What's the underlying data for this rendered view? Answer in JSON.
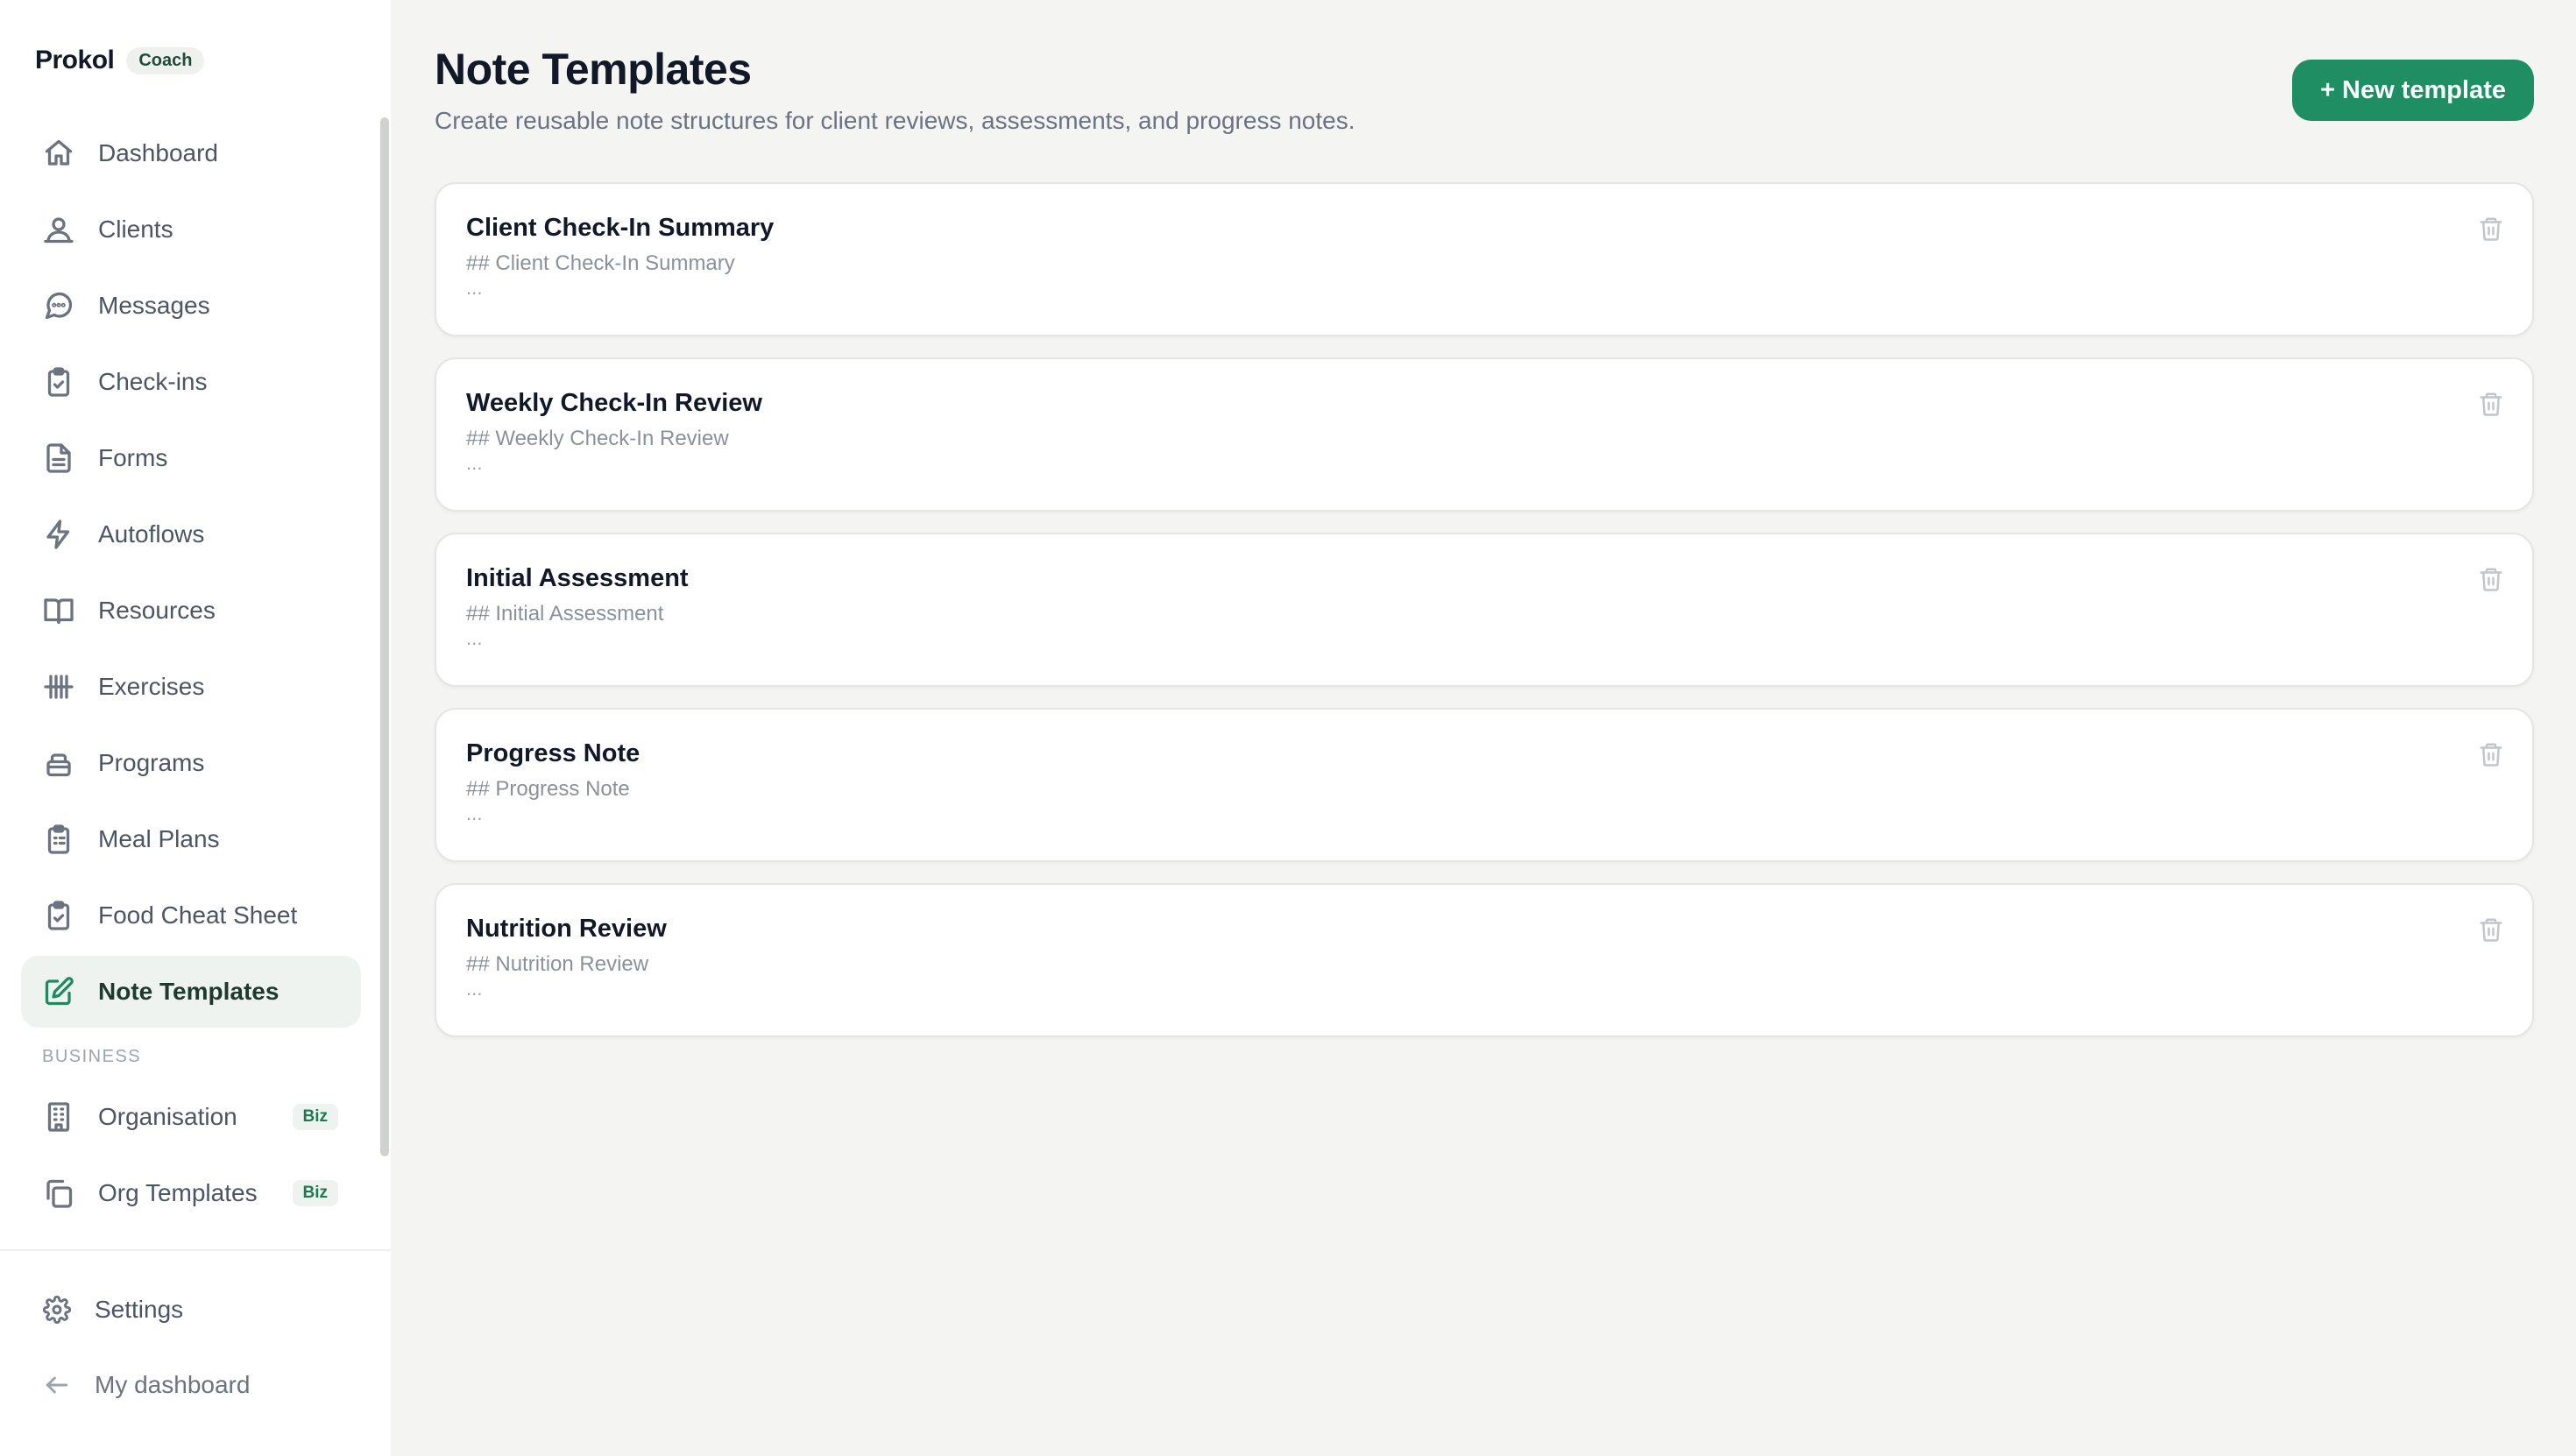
{
  "brand": {
    "name": "Prokol",
    "badge": "Coach"
  },
  "nav": [
    {
      "label": "Dashboard",
      "icon": "home-icon"
    },
    {
      "label": "Clients",
      "icon": "users-icon"
    },
    {
      "label": "Messages",
      "icon": "message-circle-icon"
    },
    {
      "label": "Check-ins",
      "icon": "clipboard-check-icon"
    },
    {
      "label": "Forms",
      "icon": "file-text-icon"
    },
    {
      "label": "Autoflows",
      "icon": "zap-icon"
    },
    {
      "label": "Resources",
      "icon": "book-open-icon"
    },
    {
      "label": "Exercises",
      "icon": "dumbbell-icon"
    },
    {
      "label": "Programs",
      "icon": "layers-icon"
    },
    {
      "label": "Meal Plans",
      "icon": "clipboard-list-icon"
    },
    {
      "label": "Food Cheat Sheet",
      "icon": "clipboard-check-icon"
    },
    {
      "label": "Note Templates",
      "icon": "edit-icon",
      "active": true
    }
  ],
  "business": {
    "section_label": "BUSINESS",
    "items": [
      {
        "label": "Organisation",
        "badge": "Biz",
        "icon": "building-icon"
      },
      {
        "label": "Org Templates",
        "badge": "Biz",
        "icon": "copy-icon"
      }
    ]
  },
  "bottom": {
    "settings_label": "Settings",
    "my_dashboard_label": "My dashboard"
  },
  "header": {
    "title": "Note Templates",
    "subtitle": "Create reusable note structures for client reviews, assessments, and progress notes.",
    "new_button_label": "+ New template"
  },
  "templates": [
    {
      "title": "Client Check-In Summary",
      "preview": "## Client Check-In Summary",
      "more": "..."
    },
    {
      "title": "Weekly Check-In Review",
      "preview": "## Weekly Check-In Review",
      "more": "..."
    },
    {
      "title": "Initial Assessment",
      "preview": "## Initial Assessment",
      "more": "..."
    },
    {
      "title": "Progress Note",
      "preview": "## Progress Note",
      "more": "..."
    },
    {
      "title": "Nutrition Review",
      "preview": "## Nutrition Review",
      "more": "..."
    }
  ],
  "colors": {
    "accent": "#1f8f63",
    "active_bg": "#eef3ef",
    "page_bg": "#f4f5f3"
  }
}
